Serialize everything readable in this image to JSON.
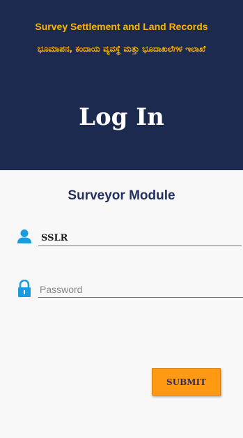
{
  "header": {
    "org_name_en": "Survey Settlement and Land Records",
    "org_name_kn": "ಭೂಮಾಪನ, ಕಂದಾಯ ವ್ಯವಸ್ಥೆ ಮತ್ತು ಭೂದಾಖಲೆಗಳ ಇಲಾಖೆ",
    "title": "Log In",
    "background_color": "#1c2a50",
    "accent_color": "#ffb300"
  },
  "form": {
    "module_title": "Surveyor Module",
    "username": {
      "icon": "user-icon",
      "value": "SSLR"
    },
    "password": {
      "icon": "lock-icon",
      "placeholder": "Password"
    },
    "submit_label": "SUBMIT",
    "submit_color": "#ff9a12",
    "icon_color": "#1a9be0"
  }
}
